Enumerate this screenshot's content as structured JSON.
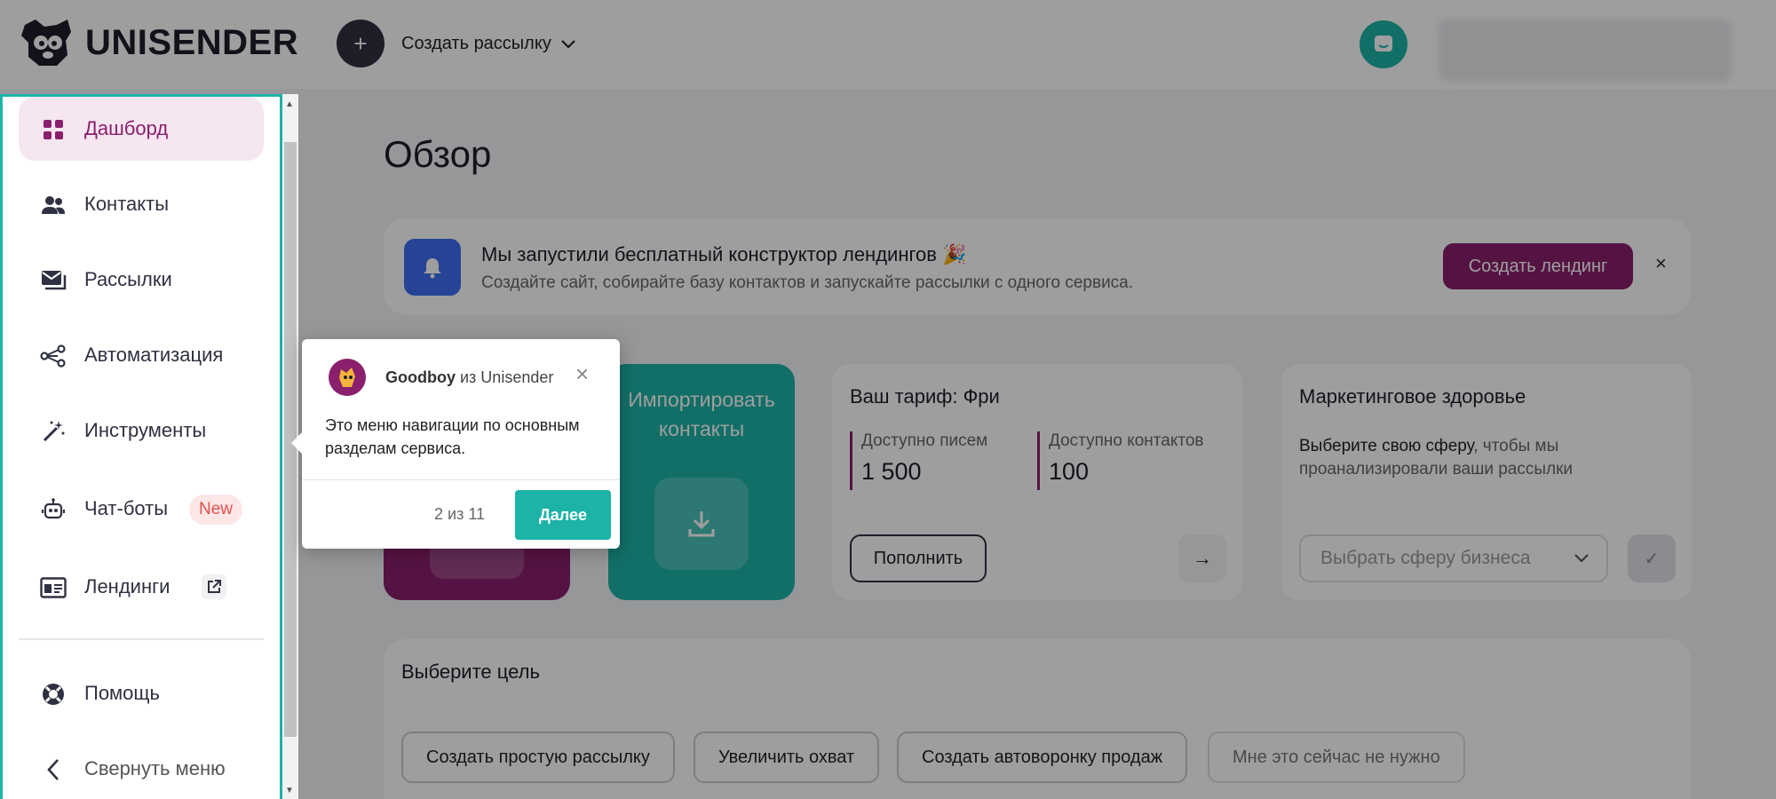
{
  "header": {
    "logo_text": "UNISENDER",
    "create_icon": "plus-icon",
    "create_label": "Создать рассылку",
    "support_icon": "chat-bubble-icon"
  },
  "page": {
    "title": "Обзор"
  },
  "banner": {
    "icon": "bell-icon",
    "title": "Мы запустили бесплатный конструктор лендингов 🎉",
    "subtitle": "Создайте сайт, собирайте базу контактов и запускайте рассылки с одного сервиса.",
    "button_label": "Создать лендинг",
    "close_label": "×",
    "accent_color": "#3e6cf0"
  },
  "cards": {
    "import": {
      "title_line1": "Импортировать",
      "title_line2": "контакты",
      "icon": "download-icon"
    },
    "tariff": {
      "title": "Ваш тариф: Фри",
      "letters_label": "Доступно писем",
      "letters_value": "1 500",
      "contacts_label": "Доступно контактов",
      "contacts_value": "100",
      "topup_label": "Пополнить",
      "arrow_label": "→"
    },
    "health": {
      "title": "Маркетинговое здоровье",
      "desc_highlight": "Выберите свою сферу",
      "desc_rest": ", чтобы мы проанализировали ваши рассылки",
      "select_placeholder": "Выбрать сферу бизнеса",
      "check_label": "✓"
    }
  },
  "goals": {
    "title": "Выберите цель",
    "buttons": [
      "Создать простую рассылку",
      "Увеличить охват",
      "Создать автоворонку продаж",
      "Мне это сейчас не нужно"
    ]
  },
  "sidebar": {
    "items": [
      {
        "label": "Дашборд",
        "icon": "dashboard-grid-icon",
        "active": true
      },
      {
        "label": "Контакты",
        "icon": "users-icon"
      },
      {
        "label": "Рассылки",
        "icon": "mail-stack-icon"
      },
      {
        "label": "Автоматизация",
        "icon": "flow-nodes-icon"
      },
      {
        "label": "Инструменты",
        "icon": "magic-wand-icon"
      },
      {
        "label": "Чат-боты",
        "icon": "robot-icon",
        "badge": "New"
      },
      {
        "label": "Лендинги",
        "icon": "landing-page-icon",
        "external_icon": "external-link-icon"
      },
      {
        "label": "Помощь",
        "icon": "lifebuoy-icon"
      },
      {
        "label": "Свернуть меню",
        "icon": "chevron-left-icon"
      }
    ]
  },
  "tooltip": {
    "author": "Goodboy",
    "author_suffix": " из Unisender",
    "message": "Это меню навигации по основным разделам сервиса.",
    "step": "2 из 11",
    "next_label": "Далее",
    "close_label": "×"
  },
  "colors": {
    "brand_purple": "#8a1f6d",
    "brand_teal": "#1db3a7",
    "new_badge": "#e0504e"
  }
}
